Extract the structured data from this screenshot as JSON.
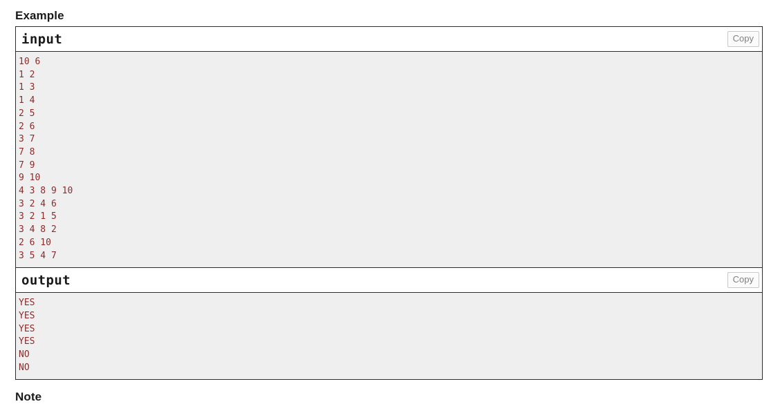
{
  "sections": {
    "example_title": "Example",
    "note_title": "Note"
  },
  "colors": {
    "code_text": "#8a2b2b",
    "panel_border": "#2b2b2b",
    "body_background": "#efeff0",
    "copy_text": "#808080"
  },
  "tests": [
    {
      "title": "input",
      "copy_label": "Copy",
      "lines": [
        "10 6",
        "1 2",
        "1 3",
        "1 4",
        "2 5",
        "2 6",
        "3 7",
        "7 8",
        "7 9",
        "9 10",
        "4 3 8 9 10",
        "3 2 4 6",
        "3 2 1 5",
        "3 4 8 2",
        "2 6 10",
        "3 5 4 7"
      ]
    },
    {
      "title": "output",
      "copy_label": "Copy",
      "lines": [
        "YES",
        "YES",
        "YES",
        "YES",
        "NO",
        "NO"
      ]
    }
  ]
}
